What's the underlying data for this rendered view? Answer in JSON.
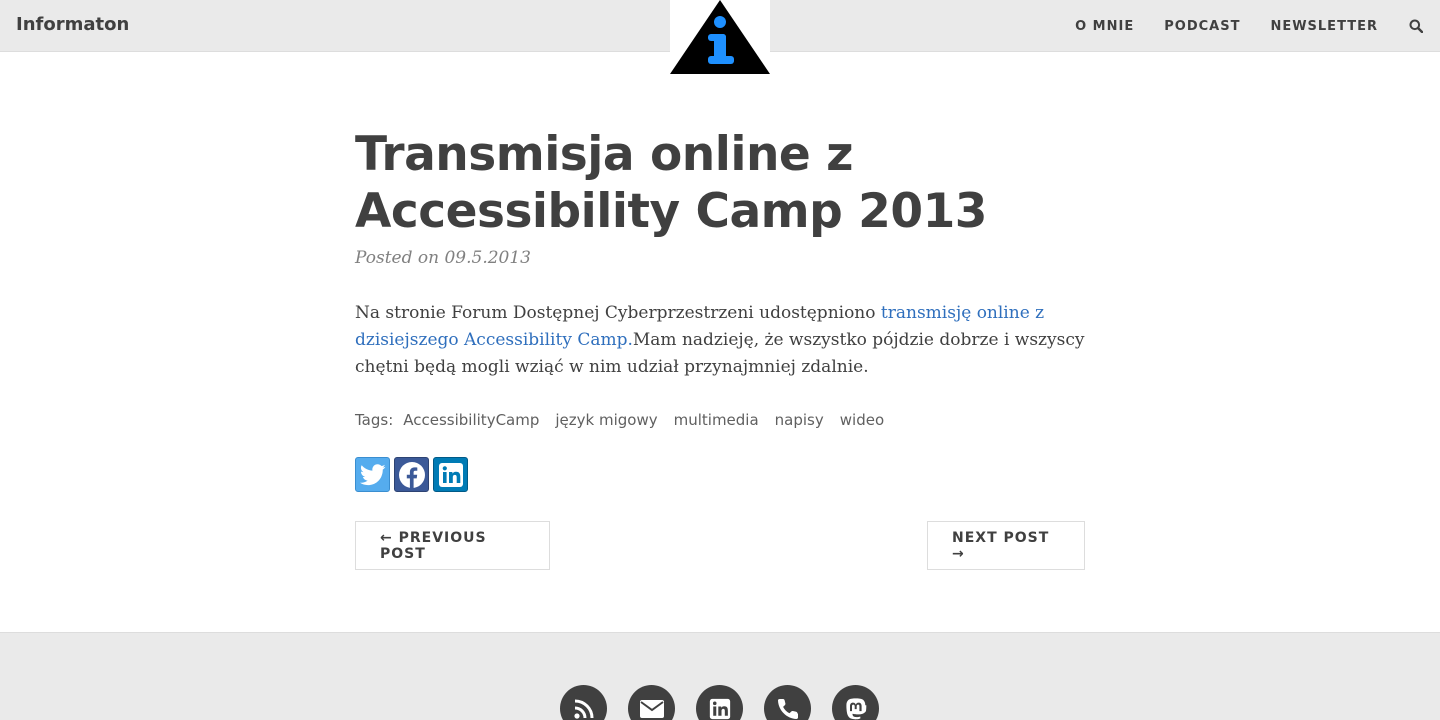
{
  "nav": {
    "brand": "Informaton",
    "links": [
      "O MNIE",
      "PODCAST",
      "NEWSLETTER"
    ],
    "search_icon": "search-icon"
  },
  "logo": {
    "icon": "info-triangle-logo",
    "colors": {
      "triangle": "#000000",
      "glyph": "#1e90ff"
    }
  },
  "post": {
    "title": "Transmisja online z Accessibility Camp 2013",
    "meta": "Posted on 09.5.2013",
    "body_before": "Na stronie Forum Dostępnej Cyberprzestrzeni udostępniono ",
    "body_link": "transmisję online z dzisiejszego Accessibility Camp.",
    "body_after": "Mam nadzieję, że wszystko pójdzie dobrze i wszyscy chętni będą mogli wziąć w nim udział przynajmniej zdalnie."
  },
  "tags": {
    "label": "Tags:",
    "items": [
      "AccessibilityCamp",
      "język migowy",
      "multimedia",
      "napisy",
      "wideo"
    ]
  },
  "share": {
    "buttons": [
      "twitter-icon",
      "facebook-icon",
      "linkedin-icon"
    ],
    "colors": {
      "twitter": "#55acee",
      "facebook": "#3b5998",
      "linkedin": "#007bb5"
    }
  },
  "pager": {
    "prev": "← PREVIOUS POST",
    "next": "NEXT POST →"
  },
  "footer": {
    "icons": [
      "rss-icon",
      "email-icon",
      "linkedin-icon",
      "phone-icon",
      "mastodon-icon"
    ]
  },
  "colors": {
    "link": "#2f6fbd",
    "text": "#404040",
    "nav_bg": "#eaeaea"
  }
}
